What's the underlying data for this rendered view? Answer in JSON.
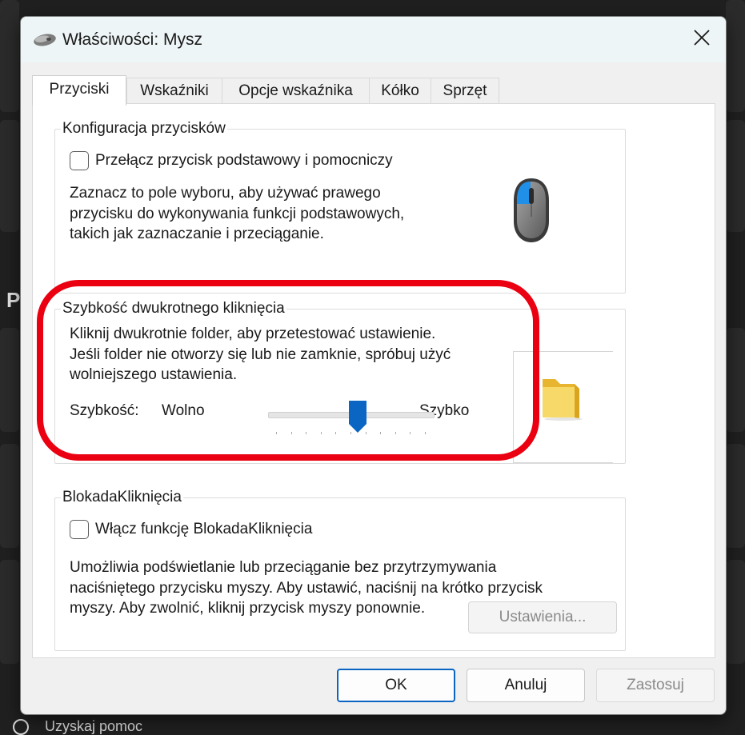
{
  "window": {
    "title": "Właściwości: Mysz",
    "close_icon": "close-icon"
  },
  "background": {
    "side_letter": "P",
    "bottom_text": "Uzyskaj pomoc"
  },
  "tabs": [
    {
      "label": "Przyciski",
      "active": true
    },
    {
      "label": "Wskaźniki",
      "active": false
    },
    {
      "label": "Opcje wskaźnika",
      "active": false
    },
    {
      "label": "Kółko",
      "active": false
    },
    {
      "label": "Sprzęt",
      "active": false
    }
  ],
  "button_config": {
    "legend": "Konfiguracja przycisków",
    "checkbox_label": "Przełącz przycisk podstawowy i pomocniczy",
    "checkbox_checked": false,
    "description": "Zaznacz to pole wyboru, aby używać prawego przycisku do wykonywania funkcji podstawowych, takich jak zaznaczanie i przeciąganie.",
    "image_icon": "mouse-icon"
  },
  "double_click": {
    "legend": "Szybkość dwukrotnego kliknięcia",
    "description": "Kliknij dwukrotnie folder, aby przetestować ustawienie. Jeśli folder nie otworzy się lub nie zamknie, spróbuj użyć wolniejszego ustawienia.",
    "speed_label": "Szybkość:",
    "slow_label": "Wolno",
    "fast_label": "Szybko",
    "slider_value": 0.55,
    "tick_count": 11,
    "folder_icon": "folder-icon"
  },
  "click_lock": {
    "legend": "BlokadaKliknięcia",
    "checkbox_label": "Włącz funkcję BlokadaKliknięcia",
    "checkbox_checked": false,
    "settings_button": "Ustawienia...",
    "description": "Umożliwia podświetlanie lub przeciąganie bez przytrzymywania naciśniętego przycisku myszy. Aby ustawić, naciśnij na krótko przycisk myszy. Aby zwolnić, kliknij przycisk myszy ponownie."
  },
  "footer": {
    "ok": "OK",
    "cancel": "Anuluj",
    "apply": "Zastosuj"
  },
  "colors": {
    "accent": "#0a66c2",
    "highlight_ring": "#ea0010"
  }
}
